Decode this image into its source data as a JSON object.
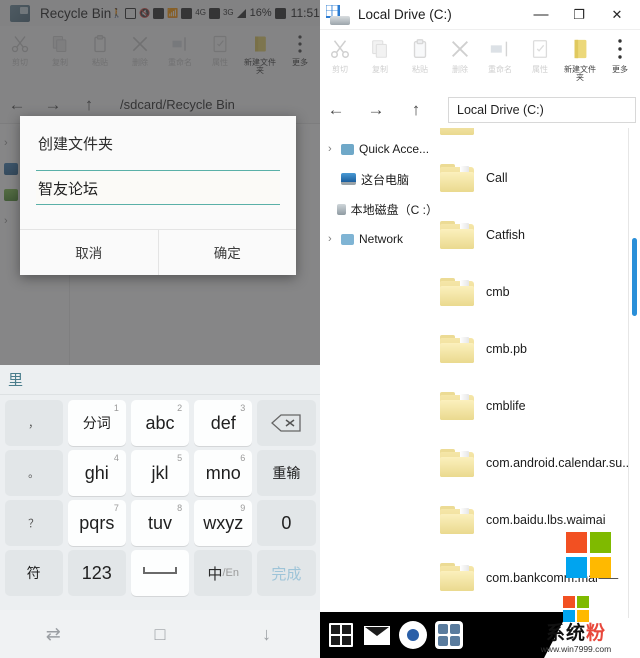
{
  "phone": {
    "status_bar": {
      "app_title": "Recycle Bin",
      "battery_percent": "16%",
      "time": "11:51",
      "net_4g": "4G",
      "net_3g": "3G",
      "close_glyph": "✕"
    },
    "toolbar": [
      {
        "label": "剪切",
        "icon": "cut-icon",
        "active": false
      },
      {
        "label": "复制",
        "icon": "copy-icon",
        "active": false
      },
      {
        "label": "粘贴",
        "icon": "paste-icon",
        "active": false
      },
      {
        "label": "删除",
        "icon": "delete-icon",
        "active": false
      },
      {
        "label": "重命名",
        "icon": "rename-icon",
        "active": false
      },
      {
        "label": "属性",
        "icon": "properties-icon",
        "active": false
      },
      {
        "label": "新建文件夹",
        "icon": "new-folder-icon",
        "active": true
      },
      {
        "label": "更多",
        "icon": "more-icon",
        "active": true
      }
    ],
    "address_bar": {
      "back_glyph": "←",
      "forward_glyph": "→",
      "up_glyph": "↑",
      "path": "/sdcard/Recycle Bin"
    },
    "tree": [
      {
        "icon": "chevron-right-icon",
        "label": ""
      },
      {
        "icon": "computer-icon",
        "label": ""
      },
      {
        "icon": "drive-icon",
        "label": ""
      },
      {
        "icon": "chevron-right-icon",
        "label": ""
      }
    ],
    "dialog": {
      "title": "创建文件夹",
      "input_value": "智友论坛",
      "input_placeholder": "",
      "cancel_label": "取消",
      "confirm_label": "确定"
    },
    "keyboard": {
      "candidate": "里",
      "rows": [
        [
          {
            "main": "，",
            "sup": "",
            "style": "tiny"
          },
          {
            "main": "分词",
            "sup": "1",
            "style": "white small"
          },
          {
            "main": "abc",
            "sup": "2",
            "style": "white"
          },
          {
            "main": "def",
            "sup": "3",
            "style": "white"
          },
          {
            "main": "backspace-icon",
            "sup": "",
            "style": "bksp"
          }
        ],
        [
          {
            "main": "。",
            "sup": "",
            "style": "tiny"
          },
          {
            "main": "ghi",
            "sup": "4",
            "style": "white"
          },
          {
            "main": "jkl",
            "sup": "5",
            "style": "white"
          },
          {
            "main": "mno",
            "sup": "6",
            "style": "white"
          },
          {
            "main": "重输",
            "sup": "",
            "style": "small"
          }
        ],
        [
          {
            "main": "？",
            "sup": "",
            "style": "tiny"
          },
          {
            "main": "pqrs",
            "sup": "7",
            "style": "white"
          },
          {
            "main": "tuv",
            "sup": "8",
            "style": "white"
          },
          {
            "main": "wxyz",
            "sup": "9",
            "style": "white"
          },
          {
            "main": "0",
            "sup": "",
            "style": ""
          }
        ],
        [
          {
            "main": "符",
            "sup": "",
            "style": "small"
          },
          {
            "main": "123",
            "sup": "",
            "style": ""
          },
          {
            "main": "space-icon",
            "sup": "",
            "style": "white space"
          },
          {
            "main": "中/En",
            "sup": "",
            "style": "zhen"
          },
          {
            "main": "完成",
            "sup": "",
            "style": "done"
          }
        ]
      ]
    },
    "nav_bar": [
      {
        "icon": "recents-icon",
        "glyph": "⇄"
      },
      {
        "icon": "home-square-icon",
        "glyph": "□"
      },
      {
        "icon": "download-arrow-icon",
        "glyph": "↓"
      }
    ]
  },
  "windows": {
    "title_bar": {
      "title": "Local Drive (C:)",
      "minimize_glyph": "—",
      "maximize_glyph": "❐",
      "close_glyph": "✕"
    },
    "toolbar": [
      {
        "label": "剪切",
        "icon": "cut-icon",
        "active": false
      },
      {
        "label": "复制",
        "icon": "copy-icon",
        "active": false
      },
      {
        "label": "粘贴",
        "icon": "paste-icon",
        "active": false
      },
      {
        "label": "删除",
        "icon": "delete-icon",
        "active": false
      },
      {
        "label": "重命名",
        "icon": "rename-icon",
        "active": false
      },
      {
        "label": "属性",
        "icon": "properties-icon",
        "active": false
      },
      {
        "label": "新建文件夹",
        "icon": "new-folder-icon",
        "active": true
      },
      {
        "label": "更多",
        "icon": "more-icon",
        "active": true
      }
    ],
    "address_bar": {
      "back_glyph": "←",
      "forward_glyph": "→",
      "up_glyph": "↑",
      "path": "Local Drive (C:)"
    },
    "sidebar": [
      {
        "chevron": "›",
        "icon": "quick-access-icon",
        "label": "Quick Acce..."
      },
      {
        "chevron": "",
        "icon": "computer-icon",
        "label": "这台电脑"
      },
      {
        "chevron": "",
        "icon": "drive-icon",
        "label": "本地磁盘（C :）"
      },
      {
        "chevron": "›",
        "icon": "network-icon",
        "label": "Network"
      }
    ],
    "files": [
      {
        "icon": "folder-icon",
        "name": ""
      },
      {
        "icon": "folder-icon",
        "name": "Call"
      },
      {
        "icon": "folder-icon",
        "name": "Catfish"
      },
      {
        "icon": "folder-icon",
        "name": "cmb"
      },
      {
        "icon": "folder-icon",
        "name": "cmb.pb"
      },
      {
        "icon": "folder-icon",
        "name": "cmblife"
      },
      {
        "icon": "folder-icon",
        "name": "com.android.calendar.su.."
      },
      {
        "icon": "folder-icon",
        "name": "com.baidu.lbs.waimai"
      },
      {
        "icon": "folder-icon",
        "name": "com.bankcomm.mai⸺"
      },
      {
        "icon": "folder-icon",
        "name": ""
      }
    ],
    "taskbar": [
      {
        "icon": "start-button-icon",
        "label": ""
      },
      {
        "icon": "mail-icon",
        "label": ""
      },
      {
        "icon": "chrome-icon",
        "label": ""
      },
      {
        "icon": "app-drawer-icon",
        "label": ""
      }
    ],
    "watermark": {
      "brand": "系统",
      "brand_accent": "粉",
      "url": "www.win7999.com"
    }
  },
  "colors": {
    "accent_teal": "#5ab0a8",
    "scrollbar_blue": "#2a8fd8",
    "folder_yellow": "#ead98f",
    "windows_blue": "#2b7cd3"
  }
}
